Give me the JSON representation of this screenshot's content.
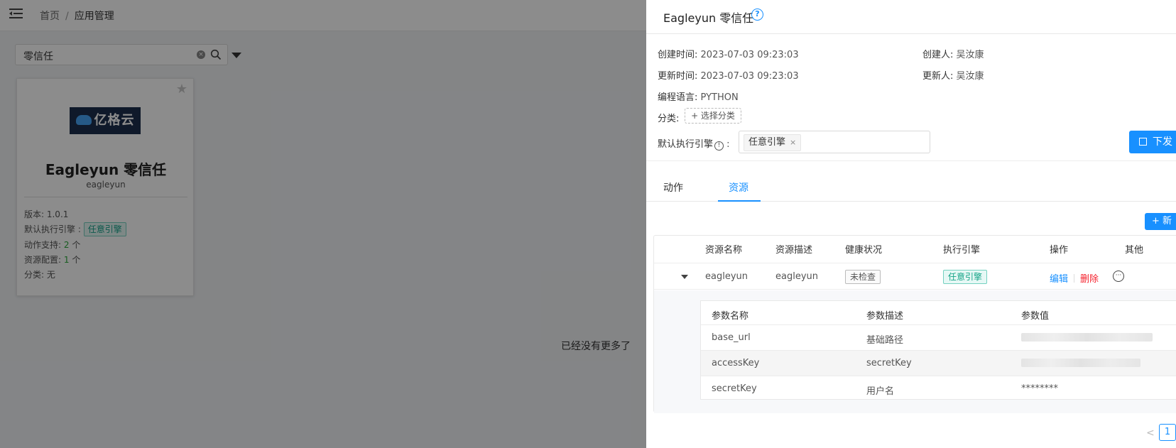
{
  "bg": {
    "breadcrumb": {
      "home": "首页",
      "sep": "/",
      "current": "应用管理"
    },
    "search": {
      "value": "零信任",
      "clear": "×"
    },
    "card": {
      "logo_text": "亿格云",
      "name": "Eagleyun 零信任",
      "subname": "eagleyun",
      "version_label": "版本: 1.0.1",
      "engine_label": "默认执行引擎 :",
      "engine_tag": "任意引擎",
      "actions_label": "动作支持:",
      "actions_num": "2",
      "actions_unit": "个",
      "resources_label": "资源配置:",
      "resources_num": "1",
      "resources_unit": "个",
      "category_label": "分类: 无"
    },
    "no_more": "已经没有更多了"
  },
  "drawer": {
    "title": "Eagleyun 零信任",
    "help": "?",
    "created_time_label": "创建时间:",
    "created_time": "2023-07-03 09:23:03",
    "creator_label": "创建人:",
    "creator": "吴汝康",
    "updated_time_label": "更新时间:",
    "updated_time": "2023-07-03 09:23:03",
    "updater_label": "更新人:",
    "updater": "吴汝康",
    "lang_label": "编程语言:",
    "lang": "PYTHON",
    "category_label": "分类:",
    "add_category": "+ 选择分类",
    "engine_label": "默认执行引擎",
    "engine_colon": ":",
    "engine_chip": "任意引擎",
    "engine_chip_close": "×",
    "dispatch": "下发",
    "tabs": [
      "动作",
      "资源"
    ],
    "new_button": "+ 新",
    "table": {
      "headers": [
        "资源名称",
        "资源描述",
        "健康状况",
        "执行引擎",
        "操作",
        "其他"
      ],
      "row": {
        "name": "eagleyun",
        "desc": "eagleyun",
        "health": "未检查",
        "engine": "任意引擎",
        "edit": "编辑",
        "delete": "删除",
        "more": "···"
      },
      "params": {
        "headers": [
          "参数名称",
          "参数描述",
          "参数值"
        ],
        "rows": [
          {
            "name": "base_url",
            "desc": "基础路径",
            "value": ""
          },
          {
            "name": "accessKey",
            "desc": "secretKey",
            "value": ""
          },
          {
            "name": "secretKey",
            "desc": "用户名",
            "value": "********"
          }
        ]
      }
    },
    "pager": {
      "prev": "<",
      "page": "1"
    }
  }
}
